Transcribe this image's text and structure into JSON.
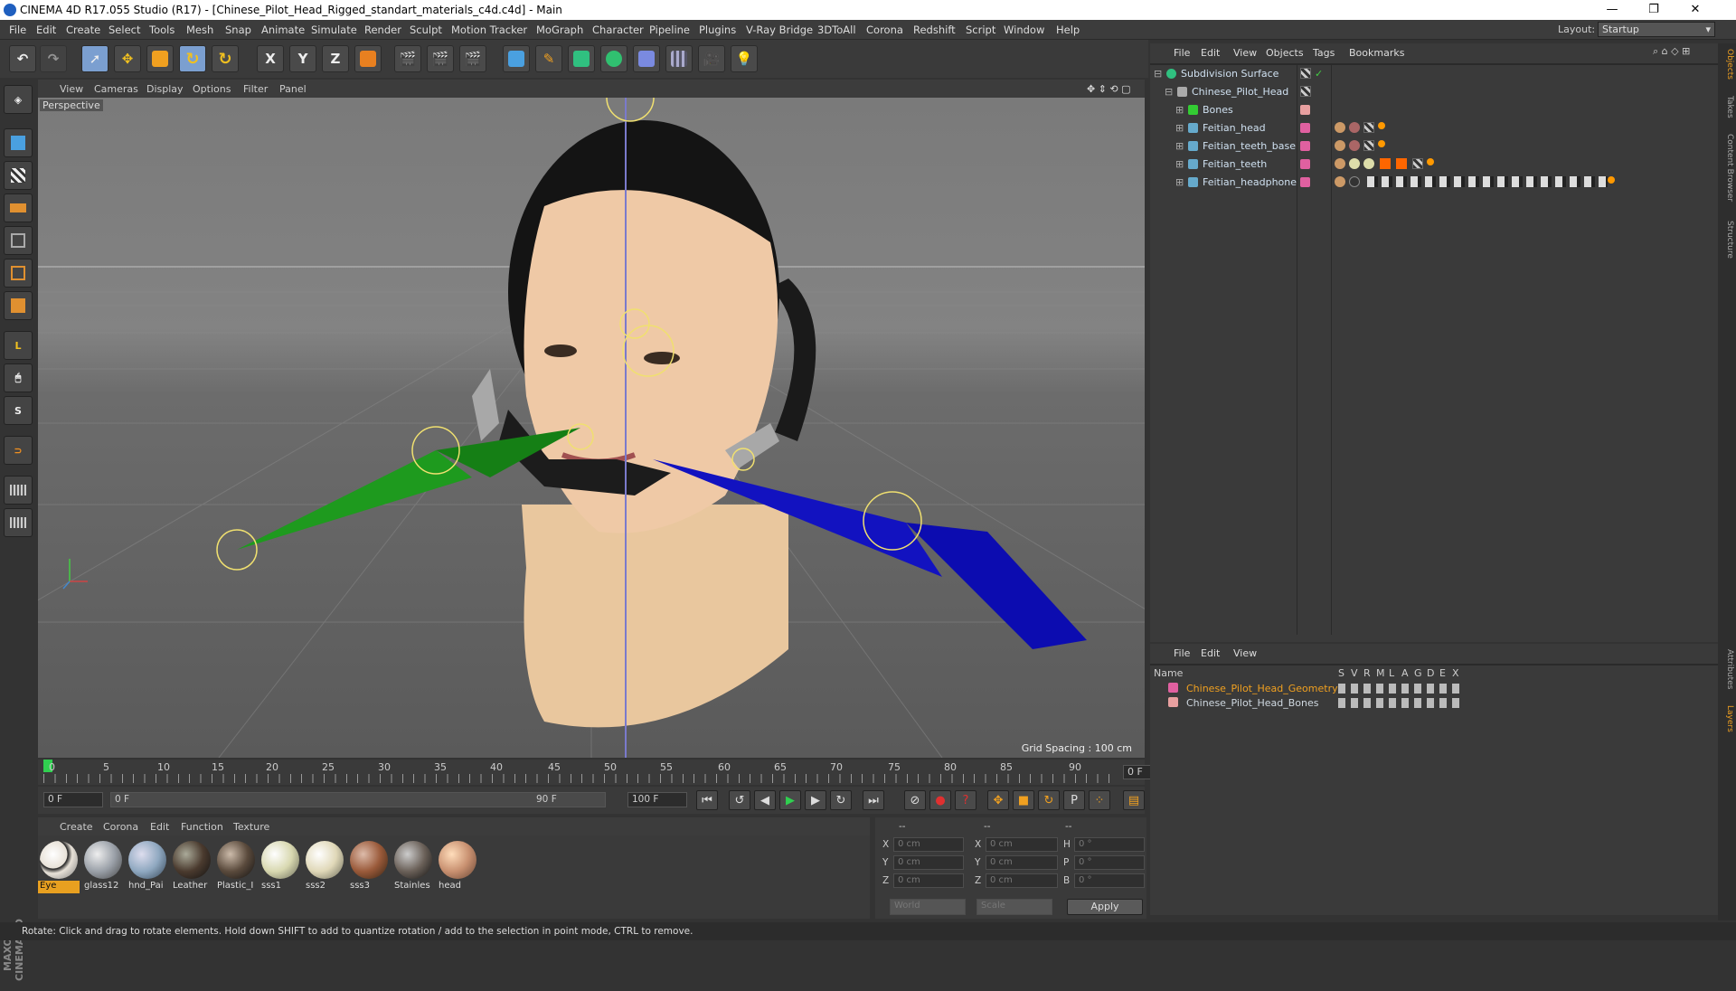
{
  "window": {
    "title": "CINEMA 4D R17.055 Studio (R17) - [Chinese_Pilot_Head_Rigged_standart_materials_c4d.c4d] - Main",
    "minimize": "—",
    "maximize": "❐",
    "close": "✕"
  },
  "menubar": {
    "items": [
      "File",
      "Edit",
      "Create",
      "Select",
      "Tools",
      "Mesh",
      "Snap",
      "Animate",
      "Simulate",
      "Render",
      "Sculpt",
      "Motion Tracker",
      "MoGraph",
      "Character",
      "Pipeline",
      "Plugins",
      "V-Ray Bridge",
      "3DToAll",
      "Corona",
      "Redshift",
      "Script",
      "Window",
      "Help"
    ],
    "layout_label": "Layout:",
    "layout_value": "Startup"
  },
  "toolbar": {
    "axis_x": "X",
    "axis_y": "Y",
    "axis_z": "Z"
  },
  "viewport": {
    "menu": [
      "View",
      "Cameras",
      "Display",
      "Options",
      "Filter",
      "Panel"
    ],
    "camera_label": "Perspective",
    "grid_spacing": "Grid Spacing : 100 cm"
  },
  "timeline": {
    "ticks": [
      "0",
      "5",
      "10",
      "15",
      "20",
      "25",
      "30",
      "35",
      "40",
      "45",
      "50",
      "55",
      "60",
      "65",
      "70",
      "75",
      "80",
      "85",
      "90"
    ],
    "current_frame": "0 F"
  },
  "transport": {
    "start_field": "0 F",
    "range_start": "0 F",
    "range_end": "90 F",
    "end_field": "100 F"
  },
  "material_manager": {
    "menu": [
      "Create",
      "Corona",
      "Edit",
      "Function",
      "Texture"
    ],
    "materials": [
      {
        "name": "Eye",
        "color": "#e8e2d8",
        "selected": true
      },
      {
        "name": "glass12",
        "color": "#9aa0a8",
        "selected": false
      },
      {
        "name": "hnd_Pai",
        "color": "#8fa8c0",
        "selected": false
      },
      {
        "name": "Leather",
        "color": "#4a3a2e",
        "selected": false
      },
      {
        "name": "Plastic_I",
        "color": "#5a4a3c",
        "selected": false
      },
      {
        "name": "sss1",
        "color": "#d8d8b0",
        "selected": false
      },
      {
        "name": "sss2",
        "color": "#e0d8b8",
        "selected": false
      },
      {
        "name": "sss3",
        "color": "#9a5a3a",
        "selected": false
      },
      {
        "name": "Stainles",
        "color": "#6a6058",
        "selected": false
      },
      {
        "name": "head",
        "color": "#c89070",
        "selected": false
      }
    ]
  },
  "coordinates": {
    "header": [
      "--",
      "--",
      "--"
    ],
    "rows": [
      {
        "a": "X",
        "av": "0 cm",
        "b": "X",
        "bv": "0 cm",
        "c": "H",
        "cv": "0 °"
      },
      {
        "a": "Y",
        "av": "0 cm",
        "b": "Y",
        "bv": "0 cm",
        "c": "P",
        "cv": "0 °"
      },
      {
        "a": "Z",
        "av": "0 cm",
        "b": "Z",
        "bv": "0 cm",
        "c": "B",
        "cv": "0 °"
      }
    ],
    "mode_world": "World",
    "mode_scale": "Scale",
    "apply": "Apply"
  },
  "object_manager": {
    "menu": [
      "File",
      "Edit",
      "View",
      "Objects",
      "Tags",
      "Bookmarks"
    ],
    "objects": [
      {
        "name": "Subdivision Surface",
        "indent": 0,
        "color": "#9ab"
      },
      {
        "name": "Chinese_Pilot_Head",
        "indent": 1,
        "color": "#aab"
      },
      {
        "name": "Bones",
        "indent": 2,
        "color": "#e8a0a0"
      },
      {
        "name": "Feitian_head",
        "indent": 2,
        "color": "#e060a0"
      },
      {
        "name": "Feitian_teeth_base",
        "indent": 2,
        "color": "#e060a0"
      },
      {
        "name": "Feitian_teeth",
        "indent": 2,
        "color": "#e060a0"
      },
      {
        "name": "Feitian_headphone",
        "indent": 2,
        "color": "#e060a0"
      }
    ]
  },
  "layer_manager": {
    "menu": [
      "File",
      "Edit",
      "View"
    ],
    "columns": {
      "name": "Name",
      "flags": [
        "S",
        "V",
        "R",
        "M",
        "L",
        "A",
        "G",
        "D",
        "E",
        "X"
      ]
    },
    "layers": [
      {
        "name": "Chinese_Pilot_Head_Geometry",
        "color": "#e060a0",
        "highlight": true
      },
      {
        "name": "Chinese_Pilot_Head_Bones",
        "color": "#e8a0a0",
        "highlight": false
      }
    ]
  },
  "side_tabs": [
    "Objects",
    "Takes",
    "Content Browser",
    "Structure",
    "Attributes",
    "Layers"
  ],
  "status": "Rotate: Click and drag to rotate elements. Hold down SHIFT to add to quantize rotation / add to the selection in point mode, CTRL to remove."
}
